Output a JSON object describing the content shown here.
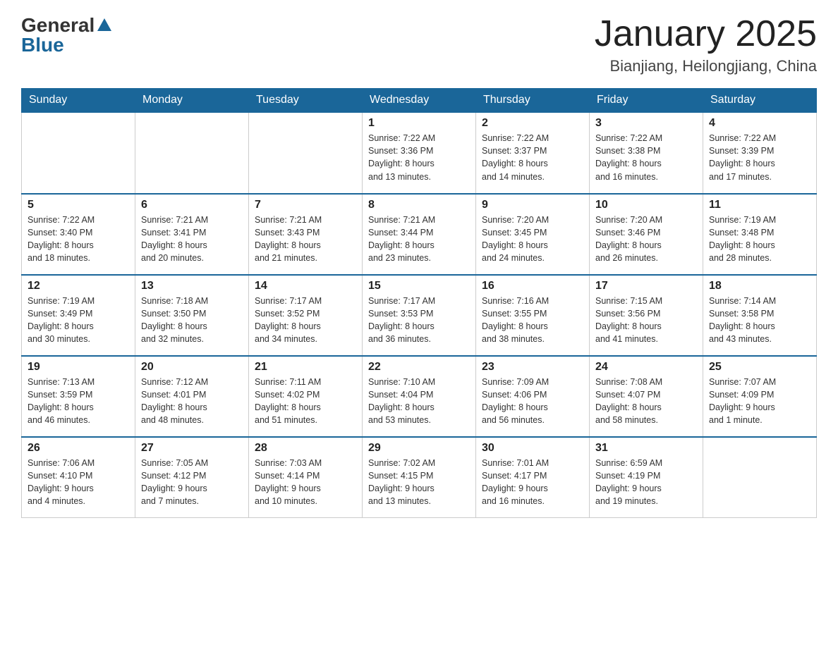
{
  "header": {
    "logo_text": "General",
    "logo_blue": "Blue",
    "month_title": "January 2025",
    "location": "Bianjiang, Heilongjiang, China"
  },
  "days_of_week": [
    "Sunday",
    "Monday",
    "Tuesday",
    "Wednesday",
    "Thursday",
    "Friday",
    "Saturday"
  ],
  "weeks": [
    [
      {
        "day": "",
        "info": ""
      },
      {
        "day": "",
        "info": ""
      },
      {
        "day": "",
        "info": ""
      },
      {
        "day": "1",
        "info": "Sunrise: 7:22 AM\nSunset: 3:36 PM\nDaylight: 8 hours\nand 13 minutes."
      },
      {
        "day": "2",
        "info": "Sunrise: 7:22 AM\nSunset: 3:37 PM\nDaylight: 8 hours\nand 14 minutes."
      },
      {
        "day": "3",
        "info": "Sunrise: 7:22 AM\nSunset: 3:38 PM\nDaylight: 8 hours\nand 16 minutes."
      },
      {
        "day": "4",
        "info": "Sunrise: 7:22 AM\nSunset: 3:39 PM\nDaylight: 8 hours\nand 17 minutes."
      }
    ],
    [
      {
        "day": "5",
        "info": "Sunrise: 7:22 AM\nSunset: 3:40 PM\nDaylight: 8 hours\nand 18 minutes."
      },
      {
        "day": "6",
        "info": "Sunrise: 7:21 AM\nSunset: 3:41 PM\nDaylight: 8 hours\nand 20 minutes."
      },
      {
        "day": "7",
        "info": "Sunrise: 7:21 AM\nSunset: 3:43 PM\nDaylight: 8 hours\nand 21 minutes."
      },
      {
        "day": "8",
        "info": "Sunrise: 7:21 AM\nSunset: 3:44 PM\nDaylight: 8 hours\nand 23 minutes."
      },
      {
        "day": "9",
        "info": "Sunrise: 7:20 AM\nSunset: 3:45 PM\nDaylight: 8 hours\nand 24 minutes."
      },
      {
        "day": "10",
        "info": "Sunrise: 7:20 AM\nSunset: 3:46 PM\nDaylight: 8 hours\nand 26 minutes."
      },
      {
        "day": "11",
        "info": "Sunrise: 7:19 AM\nSunset: 3:48 PM\nDaylight: 8 hours\nand 28 minutes."
      }
    ],
    [
      {
        "day": "12",
        "info": "Sunrise: 7:19 AM\nSunset: 3:49 PM\nDaylight: 8 hours\nand 30 minutes."
      },
      {
        "day": "13",
        "info": "Sunrise: 7:18 AM\nSunset: 3:50 PM\nDaylight: 8 hours\nand 32 minutes."
      },
      {
        "day": "14",
        "info": "Sunrise: 7:17 AM\nSunset: 3:52 PM\nDaylight: 8 hours\nand 34 minutes."
      },
      {
        "day": "15",
        "info": "Sunrise: 7:17 AM\nSunset: 3:53 PM\nDaylight: 8 hours\nand 36 minutes."
      },
      {
        "day": "16",
        "info": "Sunrise: 7:16 AM\nSunset: 3:55 PM\nDaylight: 8 hours\nand 38 minutes."
      },
      {
        "day": "17",
        "info": "Sunrise: 7:15 AM\nSunset: 3:56 PM\nDaylight: 8 hours\nand 41 minutes."
      },
      {
        "day": "18",
        "info": "Sunrise: 7:14 AM\nSunset: 3:58 PM\nDaylight: 8 hours\nand 43 minutes."
      }
    ],
    [
      {
        "day": "19",
        "info": "Sunrise: 7:13 AM\nSunset: 3:59 PM\nDaylight: 8 hours\nand 46 minutes."
      },
      {
        "day": "20",
        "info": "Sunrise: 7:12 AM\nSunset: 4:01 PM\nDaylight: 8 hours\nand 48 minutes."
      },
      {
        "day": "21",
        "info": "Sunrise: 7:11 AM\nSunset: 4:02 PM\nDaylight: 8 hours\nand 51 minutes."
      },
      {
        "day": "22",
        "info": "Sunrise: 7:10 AM\nSunset: 4:04 PM\nDaylight: 8 hours\nand 53 minutes."
      },
      {
        "day": "23",
        "info": "Sunrise: 7:09 AM\nSunset: 4:06 PM\nDaylight: 8 hours\nand 56 minutes."
      },
      {
        "day": "24",
        "info": "Sunrise: 7:08 AM\nSunset: 4:07 PM\nDaylight: 8 hours\nand 58 minutes."
      },
      {
        "day": "25",
        "info": "Sunrise: 7:07 AM\nSunset: 4:09 PM\nDaylight: 9 hours\nand 1 minute."
      }
    ],
    [
      {
        "day": "26",
        "info": "Sunrise: 7:06 AM\nSunset: 4:10 PM\nDaylight: 9 hours\nand 4 minutes."
      },
      {
        "day": "27",
        "info": "Sunrise: 7:05 AM\nSunset: 4:12 PM\nDaylight: 9 hours\nand 7 minutes."
      },
      {
        "day": "28",
        "info": "Sunrise: 7:03 AM\nSunset: 4:14 PM\nDaylight: 9 hours\nand 10 minutes."
      },
      {
        "day": "29",
        "info": "Sunrise: 7:02 AM\nSunset: 4:15 PM\nDaylight: 9 hours\nand 13 minutes."
      },
      {
        "day": "30",
        "info": "Sunrise: 7:01 AM\nSunset: 4:17 PM\nDaylight: 9 hours\nand 16 minutes."
      },
      {
        "day": "31",
        "info": "Sunrise: 6:59 AM\nSunset: 4:19 PM\nDaylight: 9 hours\nand 19 minutes."
      },
      {
        "day": "",
        "info": ""
      }
    ]
  ]
}
